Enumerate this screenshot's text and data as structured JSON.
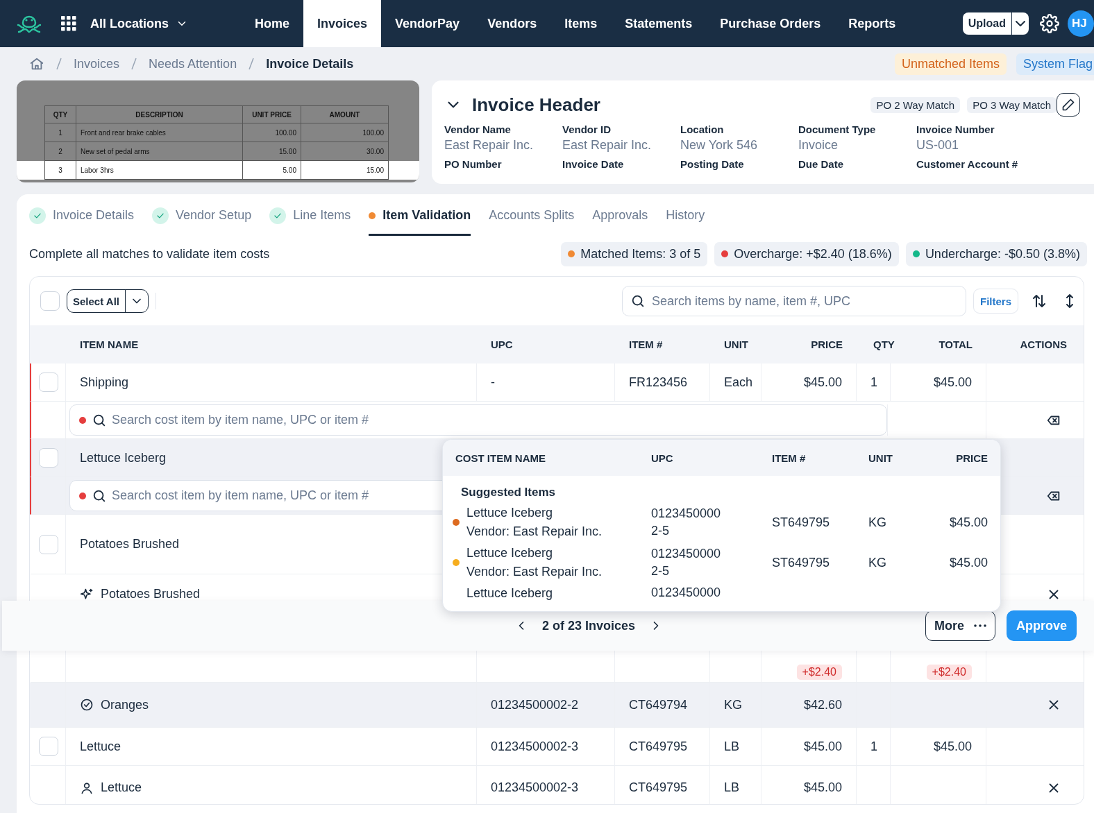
{
  "nav": {
    "location": "All Locations",
    "items": [
      {
        "label": "Home",
        "selected": false
      },
      {
        "label": "Invoices",
        "selected": true
      },
      {
        "label": "VendorPay",
        "selected": false
      },
      {
        "label": "Vendors",
        "selected": false
      },
      {
        "label": "Items",
        "selected": false
      },
      {
        "label": "Statements",
        "selected": false
      },
      {
        "label": "Purchase Orders",
        "selected": false
      },
      {
        "label": "Reports",
        "selected": false
      }
    ],
    "upload": "Upload",
    "avatar": "HJ"
  },
  "breadcrumb": [
    "Invoices",
    "Needs Attention",
    "Invoice Details"
  ],
  "flags": [
    {
      "label": "Unmatched Items",
      "kind": "warning"
    },
    {
      "label": "System Flag",
      "kind": "info"
    }
  ],
  "document": {
    "columns": [
      "QTY",
      "DESCRIPTION",
      "UNIT PRICE",
      "AMOUNT"
    ],
    "rows": [
      {
        "qty": "1",
        "description": "Front and rear brake cables",
        "unit_price": "100.00",
        "amount": "100.00",
        "highlighted": false
      },
      {
        "qty": "2",
        "description": "New set of pedal arms",
        "unit_price": "15.00",
        "amount": "30.00",
        "highlighted": false
      },
      {
        "qty": "3",
        "description": "Labor 3hrs",
        "unit_price": "5.00",
        "amount": "15.00",
        "highlighted": true
      }
    ]
  },
  "header_card": {
    "title": "Invoice Header",
    "tags": [
      "PO 2 Way Match",
      "PO 3 Way Match"
    ],
    "fields": [
      {
        "label": "Vendor Name",
        "value": "East Repair Inc."
      },
      {
        "label": "Vendor ID",
        "value": "East Repair Inc."
      },
      {
        "label": "Location",
        "value": "New York 546"
      },
      {
        "label": "Document Type",
        "value": "Invoice"
      },
      {
        "label": "Invoice Number",
        "value": "US-001"
      },
      {
        "label": "PO Number"
      },
      {
        "label": "Invoice Date"
      },
      {
        "label": "Posting Date"
      },
      {
        "label": "Due Date"
      },
      {
        "label": "Customer Account #"
      }
    ]
  },
  "tabs": [
    {
      "label": "Invoice Details",
      "kind": "done",
      "selected": false
    },
    {
      "label": "Vendor Setup",
      "kind": "done",
      "selected": false
    },
    {
      "label": "Line Items",
      "kind": "done",
      "selected": false
    },
    {
      "label": "Item Validation",
      "kind": "current",
      "selected": true
    },
    {
      "label": "Accounts Splits",
      "kind": "plain",
      "selected": false
    },
    {
      "label": "Approvals",
      "kind": "plain",
      "selected": false
    },
    {
      "label": "History",
      "kind": "plain",
      "selected": false
    }
  ],
  "subtitle": "Complete all matches to validate item costs",
  "stats": [
    {
      "label": "Matched Items: 3 of 5",
      "color": "#f08a34"
    },
    {
      "label": "Overcharge: +$2.40 (18.6%)",
      "color": "#e53e3e"
    },
    {
      "label": "Undercharge: -$0.50 (3.8%)",
      "color": "#14b88a"
    }
  ],
  "table": {
    "select_all": {
      "label": "Select All",
      "checked": false
    },
    "search": {
      "placeholder": "Search items by name, item #, UPC"
    },
    "filters": "Filters",
    "columns": [
      "ITEM NAME",
      "UPC",
      "ITEM #",
      "UNIT",
      "PRICE",
      "QTY",
      "TOTAL",
      "ACTIONS"
    ],
    "rows": [
      {
        "kind": "item",
        "checked": false,
        "flagged": true,
        "highlighted": false,
        "name": "Shipping",
        "upc": "-",
        "item_no": "FR123456",
        "unit": "Each",
        "price": "$45.00",
        "qty": "1",
        "total": "$45.00"
      },
      {
        "kind": "search",
        "flagged": true,
        "highlighted": false,
        "color": "#e53e3e",
        "placeholder": "Search cost item by item name, UPC or item #"
      },
      {
        "kind": "item",
        "checked": false,
        "flagged": true,
        "highlighted": true,
        "name": "Lettuce Iceberg"
      },
      {
        "kind": "search",
        "flagged": true,
        "highlighted": true,
        "color": "#e53e3e",
        "placeholder": "Search cost item by item name, UPC or item #"
      },
      {
        "kind": "item",
        "checked": false,
        "flagged": false,
        "highlighted": false,
        "name": "Potatoes Brushed"
      },
      {
        "kind": "suggested_match",
        "flagged": false,
        "highlighted": false,
        "name": "Potatoes Brushed",
        "removable": true
      },
      {
        "kind": "tags",
        "flagged": false,
        "highlighted": false,
        "price_tag": "+$2.40",
        "total_tag": "+$2.40"
      },
      {
        "kind": "confirmed_match",
        "flagged": false,
        "highlighted": true,
        "name": "Oranges",
        "upc": "01234500002-2",
        "item_no": "CT649794",
        "unit": "KG",
        "price": "$42.60",
        "removable": true
      },
      {
        "kind": "item",
        "checked": false,
        "flagged": false,
        "highlighted": false,
        "name": "Lettuce",
        "upc": "01234500002-3",
        "item_no": "CT649795",
        "unit": "LB",
        "price": "$45.00",
        "qty": "1",
        "total": "$45.00"
      },
      {
        "kind": "manual_match",
        "flagged": false,
        "highlighted": false,
        "name": "Lettuce",
        "upc": "01234500002-3",
        "item_no": "CT649795",
        "unit": "LB",
        "price": "$45.00",
        "removable": true
      }
    ]
  },
  "dropdown": {
    "columns": [
      "COST ITEM NAME",
      "UPC",
      "ITEM #",
      "UNIT",
      "PRICE"
    ],
    "section": "Suggested Items",
    "items": [
      {
        "name": "Lettuce Iceberg",
        "vendor": "Vendor: East Repair Inc.",
        "upc": "01234500002-5",
        "item_no": "ST649795",
        "unit": "KG",
        "price": "$45.00",
        "color": "#dd6b20"
      },
      {
        "name": "Lettuce Iceberg",
        "vendor": "Vendor: East Repair Inc.",
        "upc": "01234500002-5",
        "item_no": "ST649795",
        "unit": "KG",
        "price": "$45.00",
        "color": "#f6ad1e"
      },
      {
        "name": "Lettuce Iceberg",
        "upc": "0123450000"
      }
    ]
  },
  "footer": {
    "pager": "2 of 23 Invoices",
    "more": "More",
    "approve": "Approve"
  }
}
